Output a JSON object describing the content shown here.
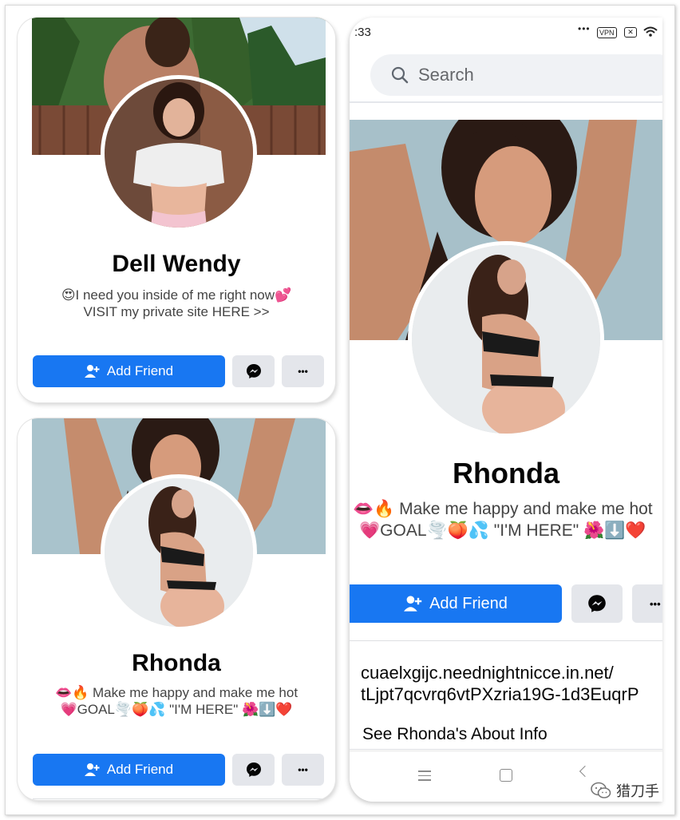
{
  "card_wendy": {
    "name": "Dell Wendy",
    "bio_line1": "😍I need you inside of me right now💕",
    "bio_line2": "VISIT my private site HERE >>",
    "add_friend_label": "Add Friend",
    "more_label": "•••"
  },
  "card_rhonda": {
    "name": "Rhonda",
    "bio_line1": "👄🔥 Make me happy and make me hot",
    "bio_line2": "💗GOAL🌪️🍑💦 \"I'M HERE\" 🌺⬇️❤️",
    "add_friend_label": "Add Friend",
    "more_label": "•••"
  },
  "phone": {
    "status_time": ":33",
    "status_vpn": "VPN",
    "search_placeholder": "Search",
    "name": "Rhonda",
    "bio_line1": "👄🔥 Make me happy and make me hot",
    "bio_line2": "💗GOAL🌪️🍑💦 \"I'M HERE\" 🌺⬇️❤️",
    "add_friend_label": "Add Friend",
    "more_label": "•••",
    "link_line1": "cuaelxgijc.neednightnicce.in.net/",
    "link_line2": "tLjpt7qcvrq6vtPXzria19G-1d3EuqrP",
    "about_link": "See Rhonda's About Info"
  },
  "watermark": {
    "text": "猎刀手"
  },
  "colors": {
    "primary": "#1877f2",
    "secondary_button": "#e4e6eb",
    "search_bg": "#f0f2f5"
  }
}
